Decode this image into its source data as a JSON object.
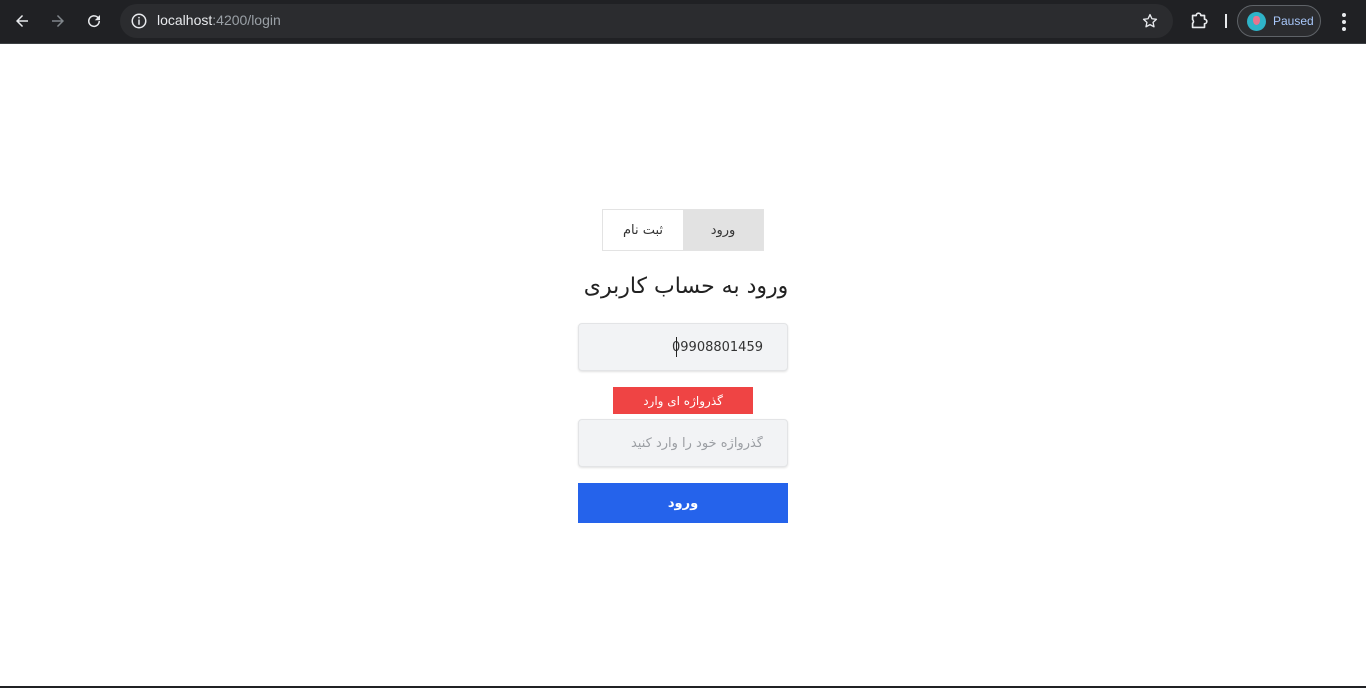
{
  "browser": {
    "url_host": "localhost",
    "url_rest": ":4200/login",
    "profile_status": "Paused"
  },
  "auth_tabs": {
    "login": "ورود",
    "register": "ثبت نام"
  },
  "login_form": {
    "title": "ورود به حساب کاربری",
    "phone_value": "09908801459",
    "error_message": "گذرواژه ای وارد",
    "password_placeholder": "گذرواژه خود را وارد کنید",
    "submit_label": "ورود"
  },
  "colors": {
    "error": "#ef4444",
    "primary": "#2563eb",
    "active_tab": "#e2e2e2"
  }
}
